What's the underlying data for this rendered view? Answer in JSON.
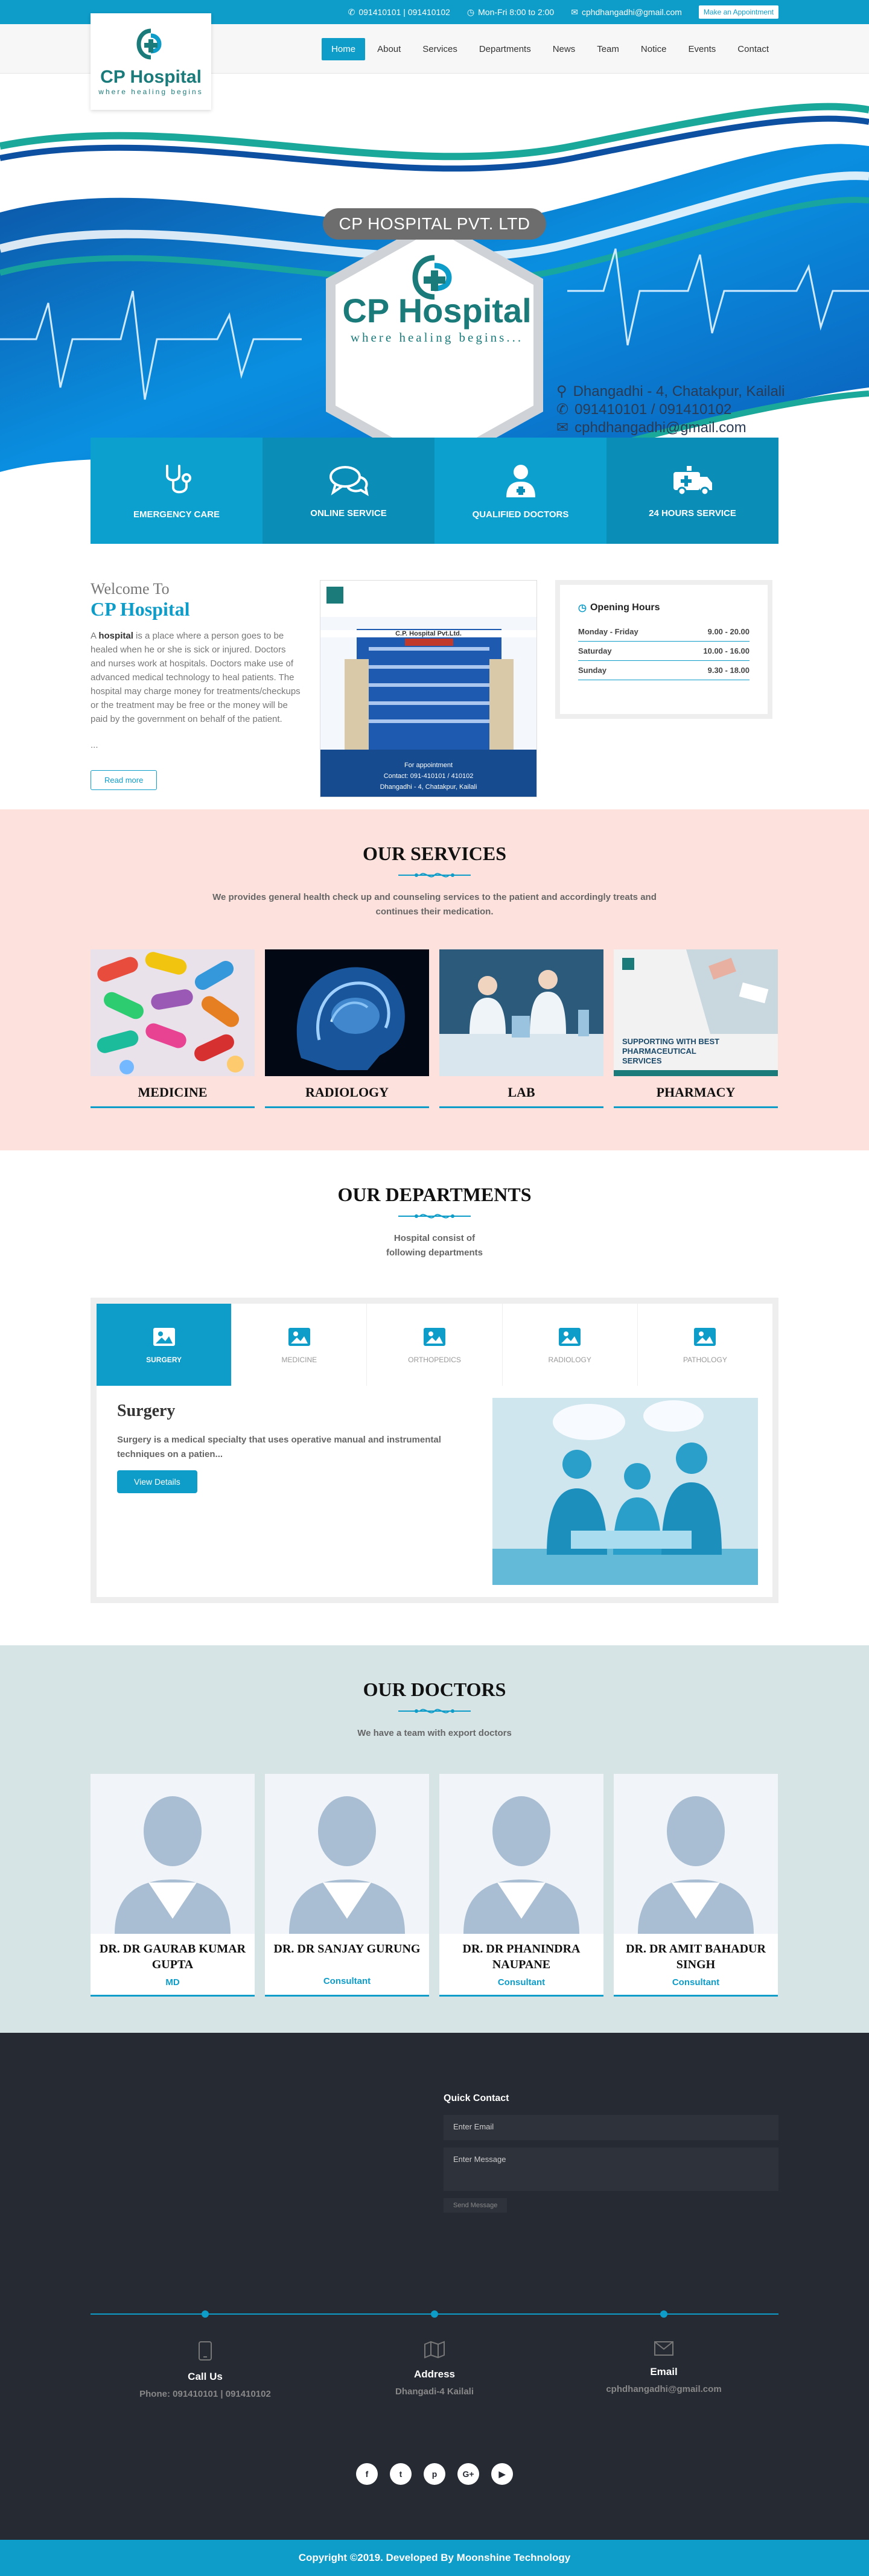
{
  "topbar": {
    "phone": "091410101 | 091410102",
    "hours": "Mon-Fri 8:00 to 2:00",
    "email": "cphdhangadhi@gmail.com",
    "appointment": "Make an Appointment"
  },
  "nav": {
    "logo_name": "CP Hospital",
    "logo_tag": "where healing begins",
    "items": [
      {
        "label": "Home"
      },
      {
        "label": "About"
      },
      {
        "label": "Services"
      },
      {
        "label": "Departments"
      },
      {
        "label": "News"
      },
      {
        "label": "Team"
      },
      {
        "label": "Notice"
      },
      {
        "label": "Events"
      },
      {
        "label": "Contact"
      }
    ]
  },
  "hero": {
    "title": "CP HOSPITAL PVT. LTD",
    "logo_name": "CP Hospital",
    "logo_tag": "where healing begins...",
    "address": "Dhangadhi - 4, Chatakpur, Kailali",
    "phone": "091410101 / 091410102",
    "email": "cphdhangadhi@gmail.com"
  },
  "features": [
    {
      "label": "EMERGENCY CARE",
      "icon": "stethoscope-icon"
    },
    {
      "label": "ONLINE SERVICE",
      "icon": "chat-icon"
    },
    {
      "label": "QUALIFIED DOCTORS",
      "icon": "doctor-icon"
    },
    {
      "label": "24 HOURS SERVICE",
      "icon": "ambulance-icon"
    }
  ],
  "welcome": {
    "heading1": "Welcome To",
    "heading2": "CP Hospital",
    "bold_word": "hospital",
    "text_pre": "A ",
    "text_post": " is a place where a person goes to be healed when he or she is sick or injured. Doctors and nurses work at hospitals. Doctors make use of advanced medical technology to heal patients. The hospital may charge money for treatments/checkups or the treatment may be free or the money will be paid by the government on behalf of the patient.",
    "ellipsis": "...",
    "read_more": "Read more",
    "poster_name": "C.P. Hospital Pvt.Ltd.",
    "poster_appt": "For appointment",
    "poster_contact": "Contact: 091-410101 / 410102",
    "poster_address": "Dhangadhi - 4, Chatakpur, Kailali"
  },
  "hours": {
    "title": "Opening Hours",
    "rows": [
      {
        "day": "Monday - Friday",
        "time": "9.00 - 20.00"
      },
      {
        "day": "Saturday",
        "time": "10.00 - 16.00"
      },
      {
        "day": "Sunday",
        "time": "9.30 - 18.00"
      }
    ]
  },
  "services": {
    "title": "OUR SERVICES",
    "subtitle": "We provides general health check up and counseling services to the patient and accordingly treats and continues their medication.",
    "items": [
      {
        "label": "MEDICINE"
      },
      {
        "label": "RADIOLOGY"
      },
      {
        "label": "LAB"
      },
      {
        "label": "PHARMACY"
      }
    ],
    "pharmacy_banner": "SUPPORTING WITH BEST PHARMACEUTICAL SERVICES"
  },
  "departments": {
    "title": "OUR DEPARTMENTS",
    "subtitle_1": "Hospital consist of",
    "subtitle_2": "following departments",
    "tabs": [
      {
        "label": "SURGERY"
      },
      {
        "label": "MEDICINE"
      },
      {
        "label": "ORTHOPEDICS"
      },
      {
        "label": "RADIOLOGY"
      },
      {
        "label": "PATHOLOGY"
      }
    ],
    "active_title": "Surgery",
    "active_text": "Surgery is a medical specialty that uses operative manual and instrumental techniques on a patien...",
    "view_details": "View Details"
  },
  "doctors": {
    "title": "OUR DOCTORS",
    "subtitle": "We have a team with export doctors",
    "items": [
      {
        "name": "DR. DR GAURAB KUMAR GUPTA",
        "role": "MD"
      },
      {
        "name": "DR. DR SANJAY GURUNG",
        "role": "Consultant"
      },
      {
        "name": "DR. DR PHANINDRA NAUPANE",
        "role": "Consultant"
      },
      {
        "name": "DR. DR AMIT BAHADUR SINGH",
        "role": "Consultant"
      }
    ]
  },
  "footer": {
    "quick_contact": "Quick Contact",
    "email_placeholder": "Enter Email",
    "message_placeholder": "Enter Message",
    "send": "Send Message",
    "cols": [
      {
        "title": "Call Us",
        "value": "Phone: 091410101 | 091410102",
        "icon": "phone-icon"
      },
      {
        "title": "Address",
        "value": "Dhangadi-4 Kailali",
        "icon": "map-icon"
      },
      {
        "title": "Email",
        "value": "cphdhangadhi@gmail.com",
        "icon": "envelope-icon"
      }
    ],
    "social": [
      {
        "glyph": "f",
        "icon": "facebook-icon"
      },
      {
        "glyph": "t",
        "icon": "twitter-icon"
      },
      {
        "glyph": "p",
        "icon": "pinterest-icon"
      },
      {
        "glyph": "G+",
        "icon": "google-plus-icon"
      },
      {
        "glyph": "▶",
        "icon": "youtube-icon"
      }
    ],
    "copyright": "Copyright ©2019. Developed By Moonshine Technology"
  },
  "colors": {
    "accent": "#0e9cc8",
    "services_bg": "#fde1dc",
    "doctors_bg": "#d6e4e6",
    "footer_bg": "#262a33"
  }
}
